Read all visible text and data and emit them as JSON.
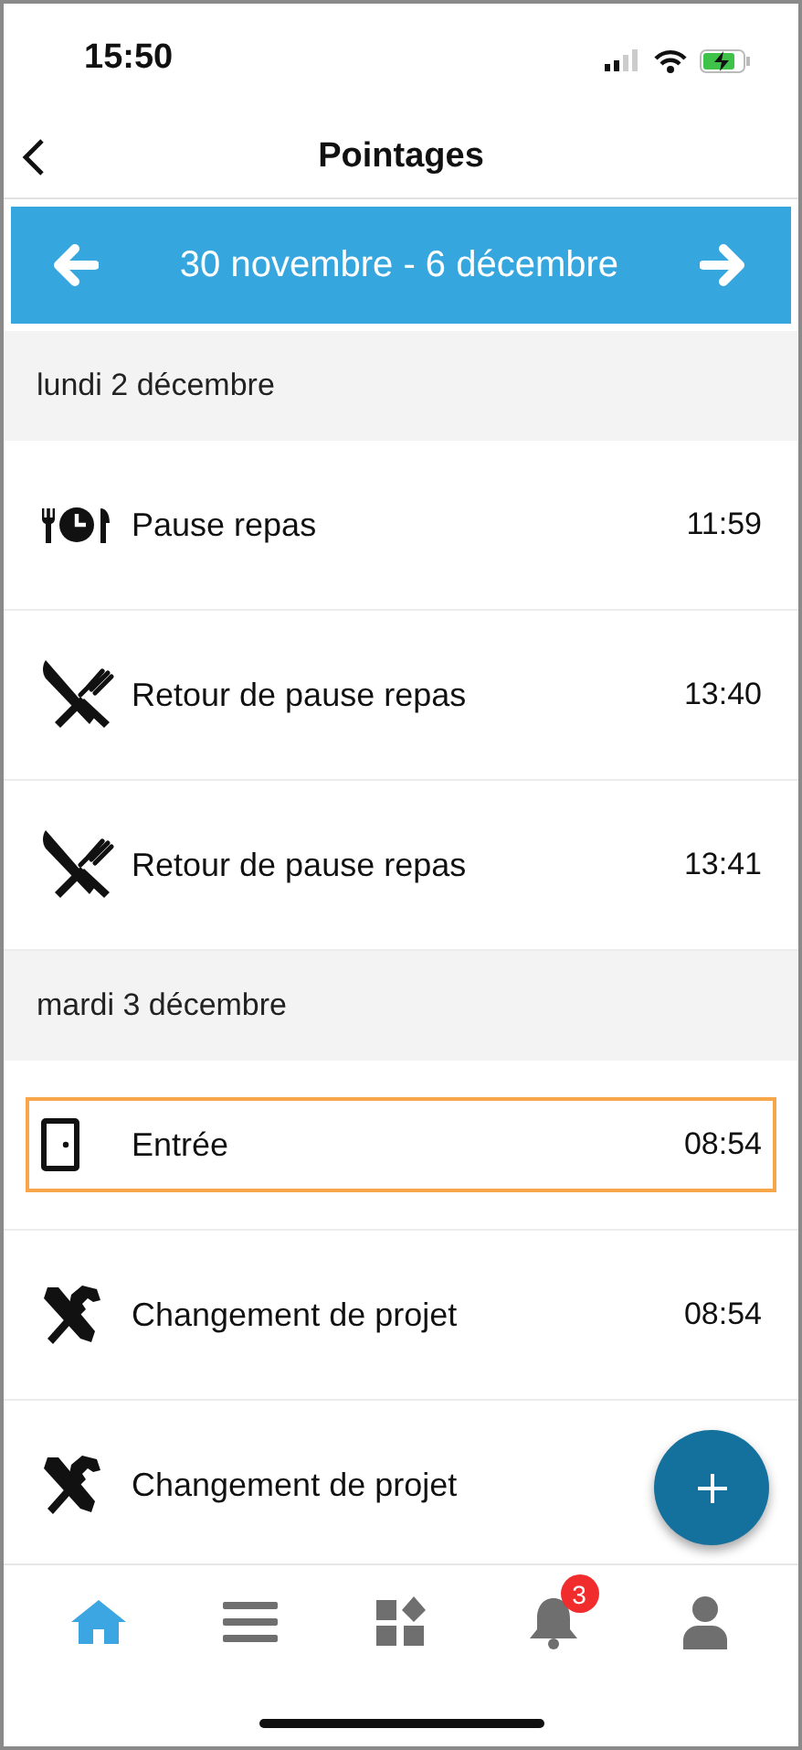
{
  "status_bar": {
    "time": "15:50"
  },
  "nav": {
    "title": "Pointages"
  },
  "week": {
    "label": "30 novembre - 6 décembre"
  },
  "days": [
    {
      "label": "lundi 2 décembre",
      "entries": [
        {
          "kind": "meal",
          "label": "Pause repas",
          "time": "11:59",
          "selected": false
        },
        {
          "kind": "utensils",
          "label": "Retour de pause repas",
          "time": "13:40",
          "selected": false
        },
        {
          "kind": "utensils",
          "label": "Retour de pause repas",
          "time": "13:41",
          "selected": false
        }
      ]
    },
    {
      "label": "mardi 3 décembre",
      "entries": [
        {
          "kind": "door",
          "label": "Entrée",
          "time": "08:54",
          "selected": true
        },
        {
          "kind": "tools",
          "label": "Changement de projet",
          "time": "08:54",
          "selected": false
        },
        {
          "kind": "tools",
          "label": "Changement de projet",
          "selected": false
        }
      ]
    }
  ],
  "tab_bar": [
    {
      "kind": "home",
      "selected": true
    },
    {
      "kind": "list",
      "selected": false
    },
    {
      "kind": "apps",
      "selected": false
    },
    {
      "kind": "bell",
      "selected": false,
      "badge": "3"
    },
    {
      "kind": "user",
      "selected": false
    }
  ]
}
